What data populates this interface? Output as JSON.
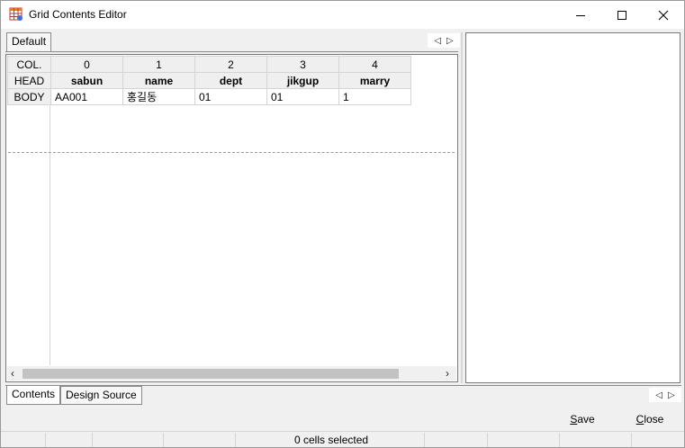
{
  "window": {
    "title": "Grid Contents Editor"
  },
  "top_tabs": [
    {
      "label": "Default"
    }
  ],
  "grid": {
    "row_labels": [
      "COL.",
      "HEAD",
      "BODY"
    ],
    "col_indices": [
      "0",
      "1",
      "2",
      "3",
      "4"
    ],
    "head": [
      "sabun",
      "name",
      "dept",
      "jikgup",
      "marry"
    ],
    "body": [
      "AA001",
      "홍길동",
      "01",
      "01",
      "1"
    ]
  },
  "bottom_tabs": [
    {
      "label": "Contents"
    },
    {
      "label": "Design Source"
    }
  ],
  "buttons": {
    "save_prefix": "",
    "save_mnemonic": "S",
    "save_rest": "ave",
    "close_prefix": "",
    "close_mnemonic": "C",
    "close_rest": "lose"
  },
  "status": {
    "text": "0 cells selected"
  },
  "icons": {
    "title": "grid-app-icon",
    "minimize": "minimize-icon",
    "maximize": "maximize-icon",
    "close": "close-icon"
  }
}
